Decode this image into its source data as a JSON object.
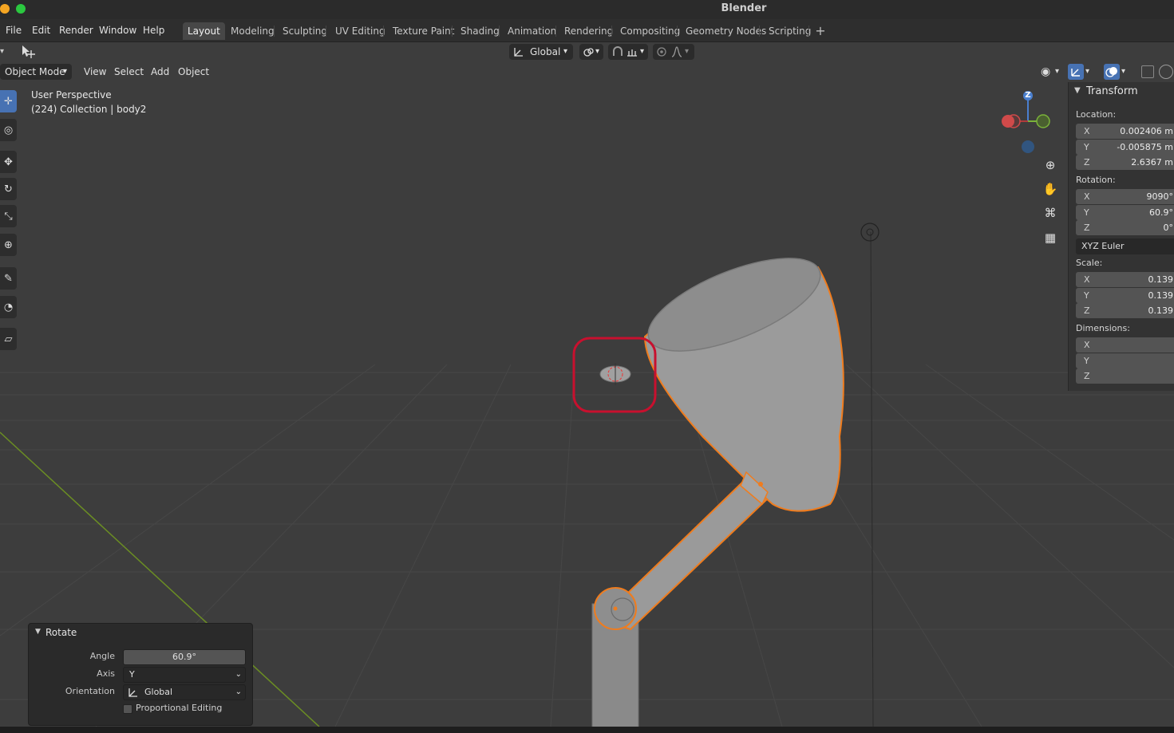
{
  "window": {
    "title": "Blender"
  },
  "menu": [
    "File",
    "Edit",
    "Render",
    "Window",
    "Help"
  ],
  "workspaces": [
    "Layout",
    "Modeling",
    "Sculpting",
    "UV Editing",
    "Texture Paint",
    "Shading",
    "Animation",
    "Rendering",
    "Compositing",
    "Geometry Nodes",
    "Scripting"
  ],
  "active_workspace": "Layout",
  "add_workspace_icon": "plus-icon",
  "toolheader": {
    "orientation": "Global",
    "icons": [
      "select-tool-icon",
      "orientation-icon",
      "pivot-icon",
      "snap-icon",
      "snap-increment-icon",
      "proportional-icon",
      "falloff-icon"
    ]
  },
  "viewport_header": {
    "mode": "Object Mode",
    "menus": [
      "View",
      "Select",
      "Add",
      "Object"
    ]
  },
  "viewport": {
    "perspective": "User Perspective",
    "context": "(224) Collection | body2",
    "gizmo_axis_label": "Z"
  },
  "sidebar": {
    "section": "Transform",
    "location_label": "Location:",
    "location": [
      {
        "axis": "X",
        "value": "0.002406 m"
      },
      {
        "axis": "Y",
        "value": "-0.005875 m"
      },
      {
        "axis": "Z",
        "value": "2.6367 m"
      }
    ],
    "rotation_label": "Rotation:",
    "rotation": [
      {
        "axis": "X",
        "value": "9090°"
      },
      {
        "axis": "Y",
        "value": "60.9°"
      },
      {
        "axis": "Z",
        "value": "0°"
      }
    ],
    "rotation_mode": "XYZ Euler",
    "scale_label": "Scale:",
    "scale": [
      {
        "axis": "X",
        "value": "0.139"
      },
      {
        "axis": "Y",
        "value": "0.139"
      },
      {
        "axis": "Z",
        "value": "0.139"
      }
    ],
    "dimensions_label": "Dimensions:",
    "dimensions": [
      {
        "axis": "X",
        "value": ""
      },
      {
        "axis": "Y",
        "value": ""
      },
      {
        "axis": "Z",
        "value": ""
      }
    ]
  },
  "operator_panel": {
    "title": "Rotate",
    "angle_label": "Angle",
    "angle": "60.9°",
    "axis_label": "Axis",
    "axis": "Y",
    "orientation_label": "Orientation",
    "orientation": "Global",
    "proportional_label": "Proportional Editing"
  },
  "colors": {
    "selection_outline": "#f07c1d",
    "highlight_circle": "#c8102e",
    "active_tool": "#4772b3"
  }
}
